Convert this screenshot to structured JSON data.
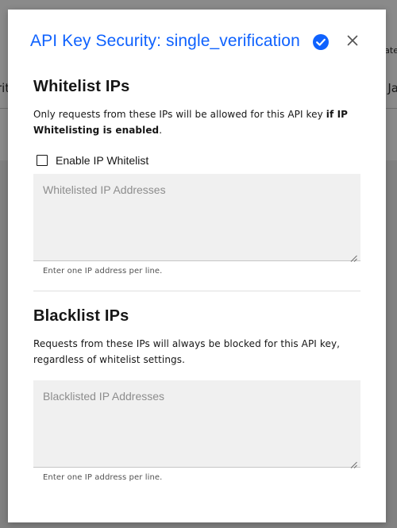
{
  "background": {
    "left_text": "rit",
    "right_top_text": "ate",
    "right_mid_text": "Ja"
  },
  "modal": {
    "title": "API Key Security: single_verification",
    "title_icon": "verified-check-icon",
    "close_icon": "close-icon",
    "accent_color": "#0f62fe"
  },
  "whitelist": {
    "heading": "Whitelist IPs",
    "description_prefix": "Only requests from these IPs will be allowed for this API key ",
    "description_bold": "if IP Whitelisting is enabled",
    "description_suffix": ".",
    "checkbox_label": "Enable IP Whitelist",
    "checkbox_checked": false,
    "textarea_placeholder": "Whitelisted IP Addresses",
    "textarea_value": "",
    "helper_text": "Enter one IP address per line."
  },
  "blacklist": {
    "heading": "Blacklist IPs",
    "description": "Requests from these IPs will always be blocked for this API key, regardless of whitelist settings.",
    "textarea_placeholder": "Blacklisted IP Addresses",
    "textarea_value": "",
    "helper_text": "Enter one IP address per line."
  }
}
